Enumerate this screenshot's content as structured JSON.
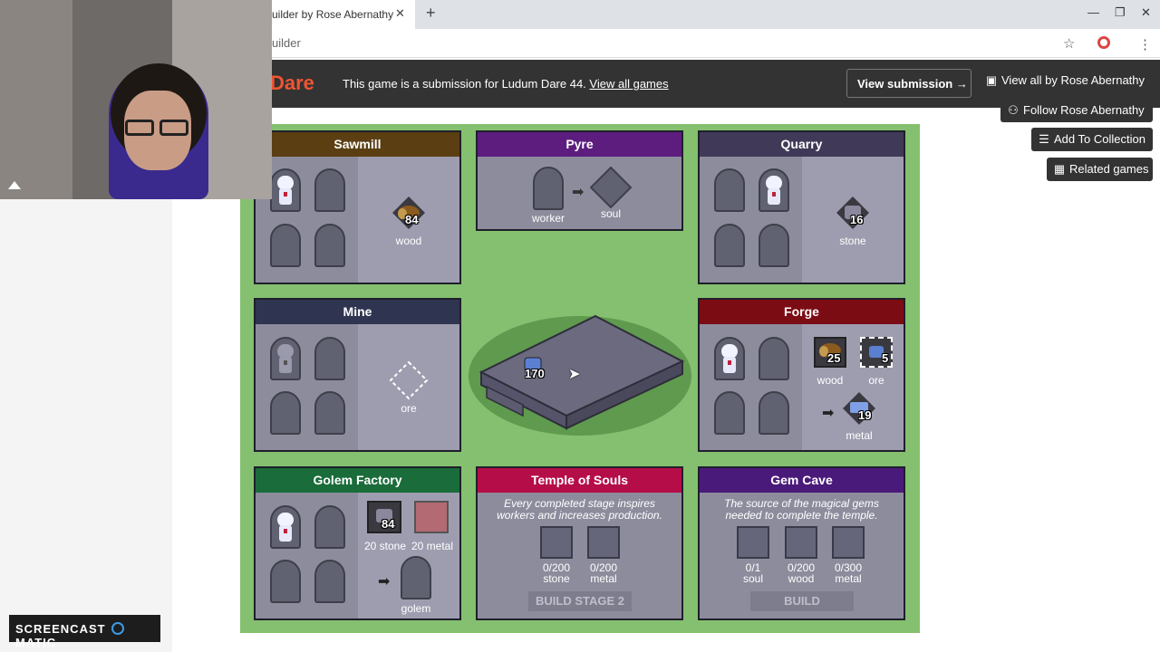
{
  "browser": {
    "tab_title": "uilder by Rose Abernathy",
    "url_text": "uilder",
    "new_tab": "+",
    "close": "✕"
  },
  "jam": {
    "logo": "Dare",
    "text": "This game is a submission for Ludum Dare 44.",
    "link": "View all games",
    "view_submission": "View submission →"
  },
  "side_buttons": [
    {
      "label": "View all by Rose Abernathy",
      "icon": "store-icon"
    },
    {
      "label": "Follow Rose Abernathy",
      "icon": "user-plus-icon"
    },
    {
      "label": "Add To Collection",
      "icon": "list-plus-icon"
    },
    {
      "label": "Related games",
      "icon": "map-icon"
    }
  ],
  "buildings": {
    "sawmill": {
      "title": "Sawmill",
      "color": "#5b3f13",
      "resource_value": "84",
      "resource_label": "wood"
    },
    "pyre": {
      "title": "Pyre",
      "color": "#5c1d7f",
      "input_label": "worker",
      "output_label": "soul"
    },
    "quarry": {
      "title": "Quarry",
      "color": "#403a58",
      "resource_value": "16",
      "resource_label": "stone"
    },
    "mine": {
      "title": "Mine",
      "color": "#2f3550",
      "resource_label": "ore"
    },
    "forge": {
      "title": "Forge",
      "color": "#7c0c14",
      "wood_value": "25",
      "wood_label": "wood",
      "ore_value": "5",
      "ore_label": "ore",
      "metal_value": "19",
      "metal_label": "metal"
    },
    "golem_factory": {
      "title": "Golem Factory",
      "color": "#1a6c3a",
      "stone_value": "84",
      "stone_label": "20 stone",
      "metal_label": "20 metal",
      "output_label": "golem"
    },
    "temple": {
      "title": "Temple of Souls",
      "color": "#b50d47",
      "description": "Every completed stage inspires workers and increases production.",
      "req": [
        {
          "count": "0/200",
          "label": "stone"
        },
        {
          "count": "0/200",
          "label": "metal"
        }
      ],
      "button": "BUILD STAGE 2"
    },
    "gem_cave": {
      "title": "Gem Cave",
      "color": "#4a1a7a",
      "description": "The source of the magical gems needed to complete the temple.",
      "req": [
        {
          "count": "0/1",
          "label": "soul"
        },
        {
          "count": "0/200",
          "label": "wood"
        },
        {
          "count": "0/300",
          "label": "metal"
        }
      ],
      "button": "BUILD"
    }
  },
  "temple_center": {
    "value": "170"
  },
  "watermark": {
    "text": "SCREENCAST",
    "text2": "MATIC"
  }
}
